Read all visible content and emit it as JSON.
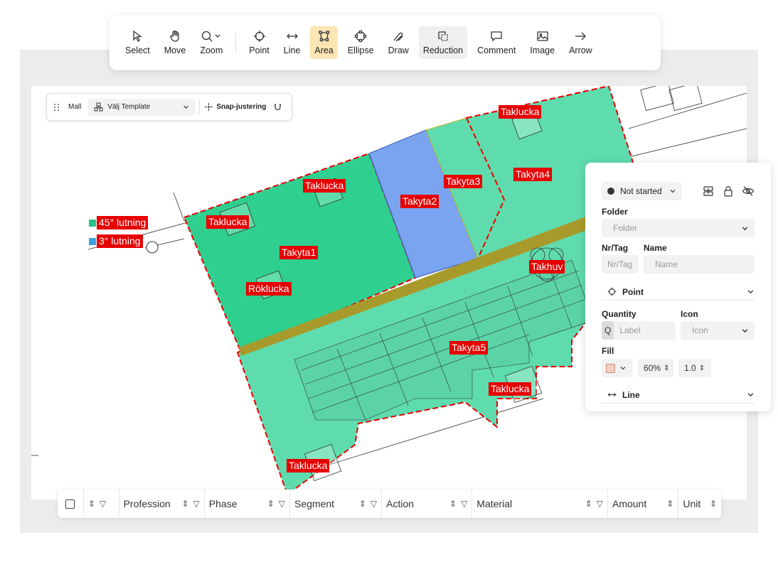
{
  "toolbar": {
    "tools": [
      {
        "label": "Select",
        "icon": "cursor-icon"
      },
      {
        "label": "Move",
        "icon": "hand-icon"
      },
      {
        "label": "Zoom",
        "icon": "zoom-icon"
      },
      {
        "label": "Point",
        "icon": "crosshair-icon"
      },
      {
        "label": "Line",
        "icon": "arrows-horizontal-icon"
      },
      {
        "label": "Area",
        "icon": "area-icon"
      },
      {
        "label": "Ellipse",
        "icon": "ellipse-icon"
      },
      {
        "label": "Draw",
        "icon": "pen-icon"
      },
      {
        "label": "Reduction",
        "icon": "reduction-icon"
      },
      {
        "label": "Comment",
        "icon": "comment-icon"
      },
      {
        "label": "Image",
        "icon": "image-icon"
      },
      {
        "label": "Arrow",
        "icon": "arrow-right-icon"
      }
    ],
    "active_tool": "Area"
  },
  "template_bar": {
    "mall_label": "Mall",
    "select_label": "Välj Template",
    "snap_label": "Snap-justering"
  },
  "plan": {
    "labels": {
      "taklucka_1": "Taklucka",
      "taklucka_2": "Taklucka",
      "taklucka_3": "Taklucka",
      "taklucka_4": "Taklucka",
      "taklucka_5": "Taklucka",
      "takyta1": "Takyta1",
      "takyta2": "Takyta2",
      "takyta3": "Takyta3",
      "takyta4": "Takyta4",
      "takyta5": "Takyta5",
      "roklucka": "Röklucka",
      "takhuv": "Takhuv"
    },
    "legend": [
      {
        "label": "45° lutning",
        "color": "#2bc18a"
      },
      {
        "label": "3° lutning",
        "color": "#3aa0e0"
      }
    ],
    "colors": {
      "green_area": "#2fd08f",
      "light_green_area": "#5fdcae",
      "blue_area": "#7aa4ef",
      "ridge": "#a89a2a",
      "tag_red": "#e60000"
    }
  },
  "panel": {
    "status": "Not started",
    "folder_label": "Folder",
    "folder_placeholder": "Folder",
    "nr_tag_label": "Nr/Tag",
    "nr_tag_placeholder": "Nr/Tag",
    "name_label": "Name",
    "name_placeholder": "Name",
    "point_section": "Point",
    "quantity_label": "Quantity",
    "quantity_prefix": "Q",
    "quantity_placeholder": "Label",
    "icon_label": "Icon",
    "icon_placeholder": "Icon",
    "fill_label": "Fill",
    "fill_opacity": "60%",
    "fill_stroke": "1.0",
    "fill_color": "#f5cfc0",
    "line_section": "Line"
  },
  "table": {
    "columns": [
      "Profession",
      "Phase",
      "Segment",
      "Action",
      "Material",
      "Amount",
      "Unit"
    ]
  }
}
